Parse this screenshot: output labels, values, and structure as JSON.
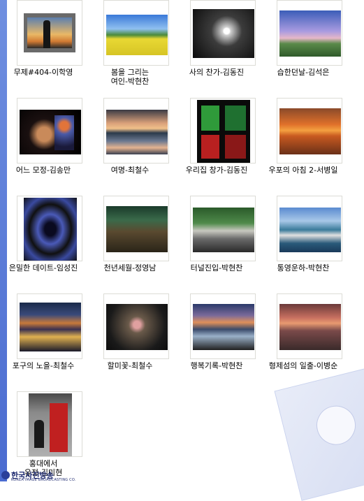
{
  "items": [
    {
      "label": "무제#404-이학영"
    },
    {
      "label": "봄을 그리는\n여인-박현찬"
    },
    {
      "label": "사의 찬가-김동진"
    },
    {
      "label": "습한던날-김석은"
    },
    {
      "label": "어느 모정-김송만"
    },
    {
      "label": "여명-최철수"
    },
    {
      "label": "우리집 창가-김동진"
    },
    {
      "label": "우포의 아침 2-서병일"
    },
    {
      "label": "은밀한 데이트-임성진"
    },
    {
      "label": "천년세월-정영남"
    },
    {
      "label": "터널진입-박현찬"
    },
    {
      "label": "통영운하-박현찬"
    },
    {
      "label": "포구의 노을-최철수"
    },
    {
      "label": "할미꽃-최철수"
    },
    {
      "label": "행복기록-박현찬"
    },
    {
      "label": "형제섬의 일출-이병순"
    },
    {
      "label": "홍대에서\n유정-김미현"
    }
  ],
  "footer": {
    "logo_name": "한국사진방송",
    "logo_sub": "KOREA IMAGE BROADCASTING CO."
  }
}
